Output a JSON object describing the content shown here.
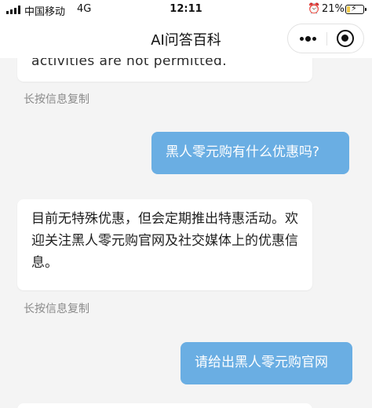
{
  "status_bar": {
    "carrier": "中国移动",
    "network": "4G",
    "time": "12:11",
    "battery_percent": "21%",
    "battery_level": 0.21,
    "battery_color": "#f2c94c"
  },
  "nav": {
    "title": "AI问答百科",
    "more_icon": "more-dots-icon",
    "close_icon": "target-close-icon"
  },
  "messages": [
    {
      "role": "ai",
      "text": "activities are not permitted."
    },
    {
      "role": "user",
      "text": "黑人零元购有什么优惠吗?"
    },
    {
      "role": "ai",
      "text": "目前无特殊优惠，但会定期推出特惠活动。欢迎关注黑人零元购官网及社交媒体上的优惠信息。"
    },
    {
      "role": "user",
      "text": "请给出黑人零元购官网"
    }
  ],
  "copy_hint": "长按信息复制",
  "colors": {
    "background": "#f4f4f4",
    "user_bubble": "#6aaee3",
    "ai_bubble": "#ffffff"
  }
}
